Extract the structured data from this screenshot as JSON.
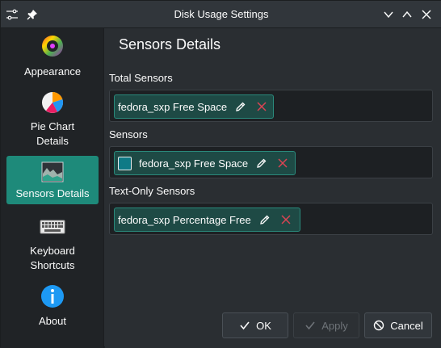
{
  "window": {
    "title": "Disk Usage Settings"
  },
  "sidebar": {
    "items": [
      {
        "label": "Appearance",
        "icon": "color-wheel-icon",
        "active": false
      },
      {
        "label": "Pie Chart Details",
        "icon": "pie-chart-icon",
        "active": false
      },
      {
        "label": "Sensors Details",
        "icon": "area-chart-icon",
        "active": true
      },
      {
        "label": "Keyboard Shortcuts",
        "icon": "keyboard-icon",
        "active": false
      },
      {
        "label": "About",
        "icon": "info-icon",
        "active": false
      }
    ]
  },
  "main": {
    "title": "Sensors Details",
    "sections": [
      {
        "label": "Total Sensors",
        "chip": "fedora_sxp Free Space"
      },
      {
        "label": "Sensors",
        "chip": "fedora_sxp Free Space"
      },
      {
        "label": "Text-Only Sensors",
        "chip": "fedora_sxp Percentage Free"
      }
    ]
  },
  "buttons": {
    "ok": "OK",
    "apply": "Apply",
    "cancel": "Cancel"
  },
  "colors": {
    "accent": "#1e8a7a",
    "chip_bg": "#1e4a45",
    "delete": "#da4453",
    "swatch": "#0f7a86"
  }
}
